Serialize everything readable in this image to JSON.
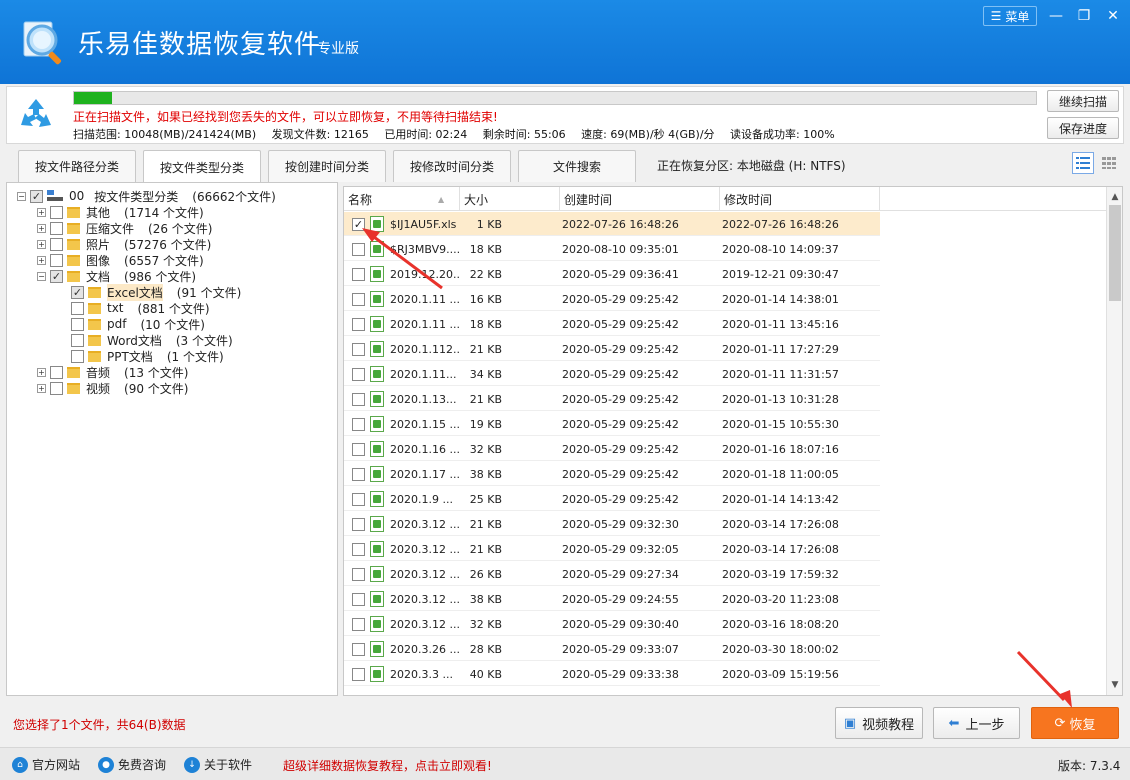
{
  "app": {
    "title": "乐易佳数据恢复软件",
    "edition": "专业版",
    "menu_label": "菜单"
  },
  "scan": {
    "progress_percent": 3.9,
    "message": "正在扫描文件，如果已经找到您丢失的文件，可以立即恢复，不用等待扫描结束!",
    "range": "扫描范围: 10048(MB)/241424(MB)",
    "found": "发现文件数: 12165",
    "elapsed": "已用时间: 02:24",
    "remaining": "剩余时间: 55:06",
    "speed": "速度: 69(MB)/秒  4(GB)/分",
    "read_rate": "读设备成功率: 100%",
    "continue_label": "继续扫描",
    "save_label": "保存进度"
  },
  "tabs": [
    {
      "label": "按文件路径分类",
      "active": false
    },
    {
      "label": "按文件类型分类",
      "active": true
    },
    {
      "label": "按创建时间分类",
      "active": false
    },
    {
      "label": "按修改时间分类",
      "active": false
    },
    {
      "label": "文件搜索",
      "active": false
    }
  ],
  "partition_info": "正在恢复分区: 本地磁盘 (H: NTFS)",
  "tree": {
    "root_code": "00",
    "root_label": "按文件类型分类",
    "root_count": "(66662个文件)",
    "items": [
      {
        "label": "其他",
        "count": "(1714 个文件)"
      },
      {
        "label": "压缩文件",
        "count": "(26 个文件)"
      },
      {
        "label": "照片",
        "count": "(57276 个文件)"
      },
      {
        "label": "图像",
        "count": "(6557 个文件)"
      },
      {
        "label": "文档",
        "count": "(986 个文件)"
      },
      {
        "label": "Excel文档",
        "count": "(91 个文件)"
      },
      {
        "label": "txt",
        "count": "(881 个文件)"
      },
      {
        "label": "pdf",
        "count": "(10 个文件)"
      },
      {
        "label": "Word文档",
        "count": "(3 个文件)"
      },
      {
        "label": "PPT文档",
        "count": "(1 个文件)"
      },
      {
        "label": "音频",
        "count": "(13 个文件)"
      },
      {
        "label": "视频",
        "count": "(90 个文件)"
      }
    ]
  },
  "list": {
    "columns": [
      "名称",
      "大小",
      "创建时间",
      "修改时间"
    ],
    "rows": [
      {
        "name": "$IJ1AU5F.xls",
        "size": "1 KB",
        "created": "2022-07-26  16:48:26",
        "modified": "2022-07-26  16:48:26",
        "checked": true
      },
      {
        "name": "$RJ3MBV9....",
        "size": "18 KB",
        "created": "2020-08-10  09:35:01",
        "modified": "2020-08-10  14:09:37",
        "checked": false
      },
      {
        "name": "2019.12.20...",
        "size": "22 KB",
        "created": "2020-05-29  09:36:41",
        "modified": "2019-12-21  09:30:47",
        "checked": false
      },
      {
        "name": "2020.1.11 ...",
        "size": "16 KB",
        "created": "2020-05-29  09:25:42",
        "modified": "2020-01-14  14:38:01",
        "checked": false
      },
      {
        "name": "2020.1.11 ...",
        "size": "18 KB",
        "created": "2020-05-29  09:25:42",
        "modified": "2020-01-11  13:45:16",
        "checked": false
      },
      {
        "name": "2020.1.112...",
        "size": "21 KB",
        "created": "2020-05-29  09:25:42",
        "modified": "2020-01-11  17:27:29",
        "checked": false
      },
      {
        "name": "2020.1.11...",
        "size": "34 KB",
        "created": "2020-05-29  09:25:42",
        "modified": "2020-01-11  11:31:57",
        "checked": false
      },
      {
        "name": "2020.1.13...",
        "size": "21 KB",
        "created": "2020-05-29  09:25:42",
        "modified": "2020-01-13  10:31:28",
        "checked": false
      },
      {
        "name": "2020.1.15 ...",
        "size": "19 KB",
        "created": "2020-05-29  09:25:42",
        "modified": "2020-01-15  10:55:30",
        "checked": false
      },
      {
        "name": "2020.1.16 ...",
        "size": "32 KB",
        "created": "2020-05-29  09:25:42",
        "modified": "2020-01-16  18:07:16",
        "checked": false
      },
      {
        "name": "2020.1.17 ...",
        "size": "38 KB",
        "created": "2020-05-29  09:25:42",
        "modified": "2020-01-18  11:00:05",
        "checked": false
      },
      {
        "name": "2020.1.9 ...",
        "size": "25 KB",
        "created": "2020-05-29  09:25:42",
        "modified": "2020-01-14  14:13:42",
        "checked": false
      },
      {
        "name": "2020.3.12 ...",
        "size": "21 KB",
        "created": "2020-05-29  09:32:30",
        "modified": "2020-03-14  17:26:08",
        "checked": false
      },
      {
        "name": "2020.3.12 ...",
        "size": "21 KB",
        "created": "2020-05-29  09:32:05",
        "modified": "2020-03-14  17:26:08",
        "checked": false
      },
      {
        "name": "2020.3.12 ...",
        "size": "26 KB",
        "created": "2020-05-29  09:27:34",
        "modified": "2020-03-19  17:59:32",
        "checked": false
      },
      {
        "name": "2020.3.12 ...",
        "size": "38 KB",
        "created": "2020-05-29  09:24:55",
        "modified": "2020-03-20  11:23:08",
        "checked": false
      },
      {
        "name": "2020.3.12 ...",
        "size": "32 KB",
        "created": "2020-05-29  09:30:40",
        "modified": "2020-03-16  18:08:20",
        "checked": false
      },
      {
        "name": "2020.3.26 ...",
        "size": "28 KB",
        "created": "2020-05-29  09:33:07",
        "modified": "2020-03-30  18:00:02",
        "checked": false
      },
      {
        "name": "2020.3.3 ...",
        "size": "40 KB",
        "created": "2020-05-29  09:33:38",
        "modified": "2020-03-09  15:19:56",
        "checked": false
      }
    ]
  },
  "bottom": {
    "selection_info": "您选择了1个文件，共64(B)数据",
    "video_label": "视频教程",
    "prev_label": "上一步",
    "recover_label": "恢复"
  },
  "status": {
    "website": "官方网站",
    "consult": "免费咨询",
    "about": "关于软件",
    "promo": "超级详细数据恢复教程，点击立即观看!",
    "version": "版本: 7.3.4"
  },
  "colors": {
    "title_bar": "#1280dc",
    "progress": "#1eb21e",
    "warning_text": "#e00000",
    "recover_button": "#f7751f",
    "annotation_arrow": "#e8322b"
  }
}
